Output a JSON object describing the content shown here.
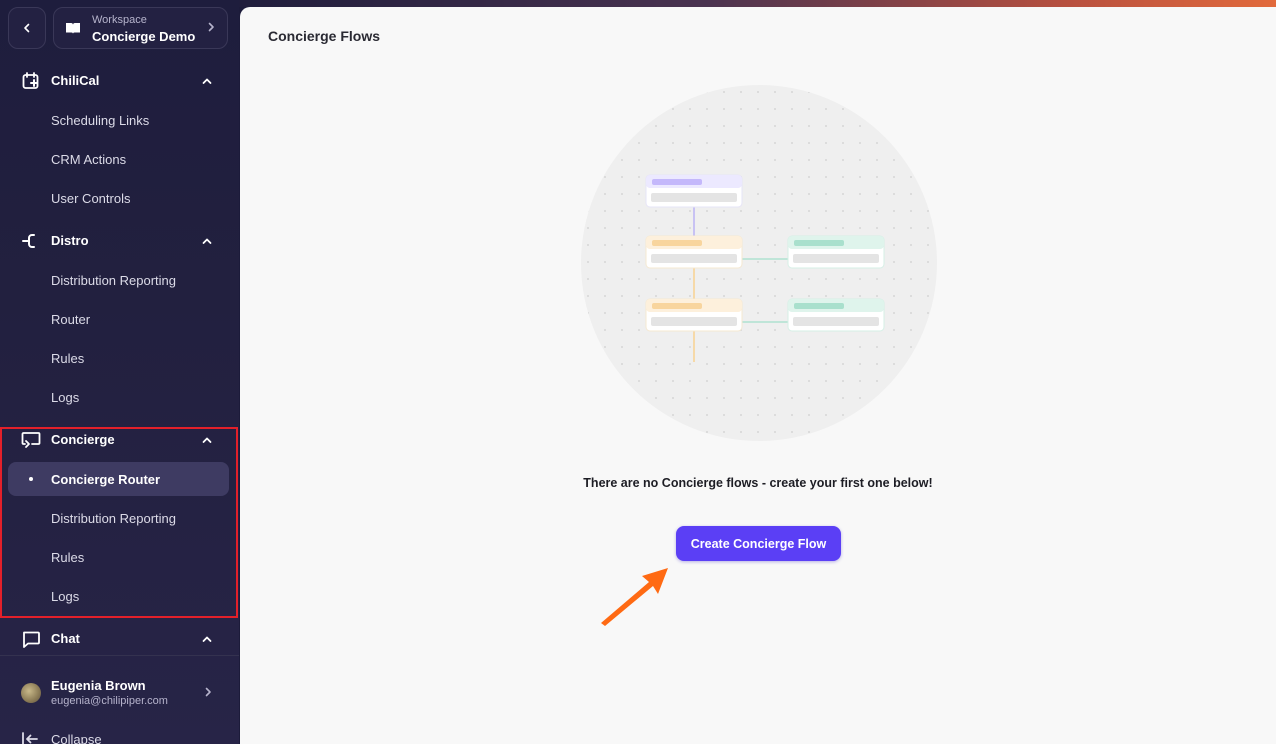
{
  "sidebar": {
    "workspace": {
      "label": "Workspace",
      "name": "Concierge Demo"
    },
    "sections": [
      {
        "title": "ChiliCal",
        "items": [
          "Scheduling Links",
          "CRM Actions",
          "User Controls"
        ]
      },
      {
        "title": "Distro",
        "items": [
          "Distribution Reporting",
          "Router",
          "Rules",
          "Logs"
        ]
      },
      {
        "title": "Concierge",
        "items": [
          "Concierge Router",
          "Distribution Reporting",
          "Rules",
          "Logs"
        ],
        "active_item": "Concierge Router"
      },
      {
        "title": "Chat",
        "items": []
      }
    ],
    "user": {
      "name": "Eugenia Brown",
      "email": "eugenia@chilipiper.com"
    },
    "collapse_label": "Collapse"
  },
  "main": {
    "title": "Concierge Flows",
    "empty_message": "There are no Concierge flows - create your first one below!",
    "create_button": "Create Concierge Flow"
  },
  "colors": {
    "accent": "#5b3ff5",
    "highlight_box": "#e3202a",
    "arrow": "#ff6a13"
  },
  "icons": {
    "back": "chevron-left-icon",
    "workspace": "book-icon",
    "chilical": "calendar-plus-icon",
    "distro": "distro-branch-icon",
    "concierge": "concierge-screen-icon",
    "chat": "chat-bubble-icon",
    "collapse": "collapse-left-icon"
  }
}
